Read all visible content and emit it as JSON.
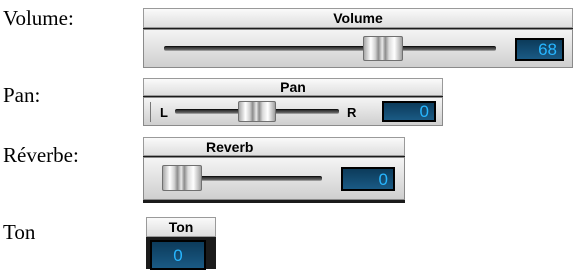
{
  "labels": {
    "volume": "Volume:",
    "pan": "Pan:",
    "reverb": "Réverbe:",
    "ton": "Ton"
  },
  "volume_widget": {
    "title": "Volume",
    "value": "68",
    "level": 0.68
  },
  "pan_widget": {
    "title": "Pan",
    "left_label": "L",
    "right_label": "R",
    "value": "0",
    "level": 0.5
  },
  "reverb_widget": {
    "title": "Reverb",
    "value": "0",
    "level": 0.0
  },
  "ton_widget": {
    "title": "Ton",
    "value": "0"
  },
  "colors": {
    "value_text": "#27b6ff",
    "value_bg": "#0c3b5b",
    "header_bg": "#e8e8e8"
  }
}
